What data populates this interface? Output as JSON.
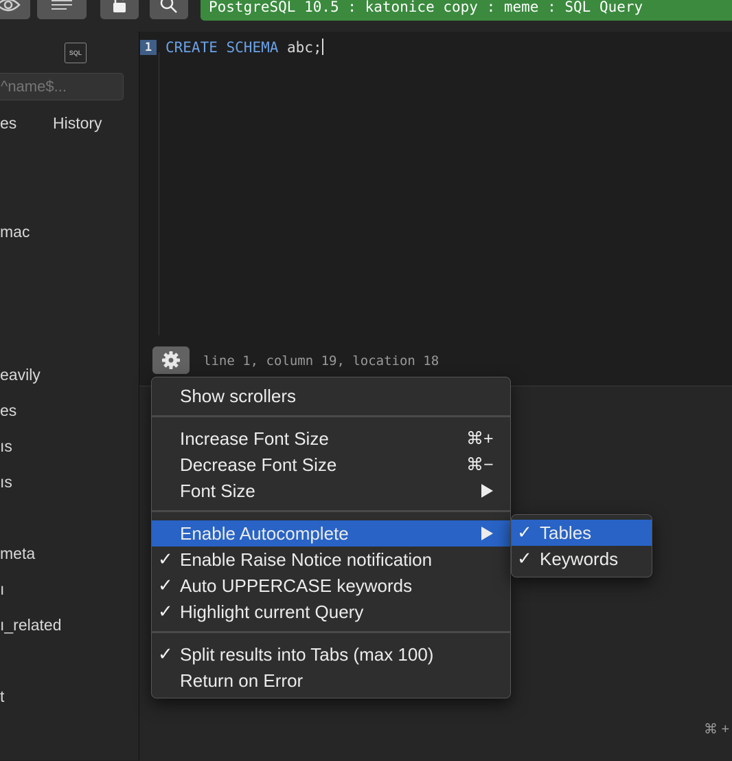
{
  "window_title": "PostgreSQL 10.5 : katonice copy : meme : SQL Query",
  "toolbar": {
    "eye_icon": "eye-icon",
    "list_icon": "list-icon",
    "lock_icon": "lock-icon",
    "search_icon": "search-icon",
    "title_color": "#3b8a3e"
  },
  "sidebar": {
    "sql_badge": "SQL",
    "filter_placeholder": "^name$...",
    "tabs": [
      "es",
      "History"
    ],
    "items": [
      "mac",
      "eavily",
      "es",
      "ıs",
      "ıs",
      "meta",
      "ı",
      "ı_related",
      "t"
    ]
  },
  "editor": {
    "line_number": "1",
    "code_keyword_1": "CREATE",
    "code_keyword_2": "SCHEMA",
    "code_rest": "abc;",
    "keyword_color": "#6aa2e6",
    "status": "line 1, column 19, location 18"
  },
  "results": {
    "shortcut_hint": "⌘ +"
  },
  "menu": {
    "highlight_color": "#2863c5",
    "items": [
      {
        "label": "Show scrollers",
        "checked": false,
        "shortcut": "",
        "submenu": false
      },
      {
        "label": "Increase Font Size",
        "checked": false,
        "shortcut": "⌘+",
        "submenu": false
      },
      {
        "label": "Decrease Font Size",
        "checked": false,
        "shortcut": "⌘−",
        "submenu": false
      },
      {
        "label": "Font Size",
        "checked": false,
        "shortcut": "",
        "submenu": true
      },
      {
        "label": "Enable Autocomplete",
        "checked": false,
        "shortcut": "",
        "submenu": true,
        "highlighted": true
      },
      {
        "label": "Enable Raise Notice notification",
        "checked": true,
        "shortcut": "",
        "submenu": false
      },
      {
        "label": "Auto UPPERCASE keywords",
        "checked": true,
        "shortcut": "",
        "submenu": false
      },
      {
        "label": "Highlight current Query",
        "checked": true,
        "shortcut": "",
        "submenu": false
      },
      {
        "label": "Split results into Tabs (max 100)",
        "checked": true,
        "shortcut": "",
        "submenu": false
      },
      {
        "label": "Return on Error",
        "checked": false,
        "shortcut": "",
        "submenu": false
      }
    ],
    "check_mark": "✓"
  },
  "submenu": {
    "items": [
      {
        "label": "Tables",
        "checked": true,
        "highlighted": true
      },
      {
        "label": "Keywords",
        "checked": true,
        "highlighted": false
      }
    ]
  }
}
